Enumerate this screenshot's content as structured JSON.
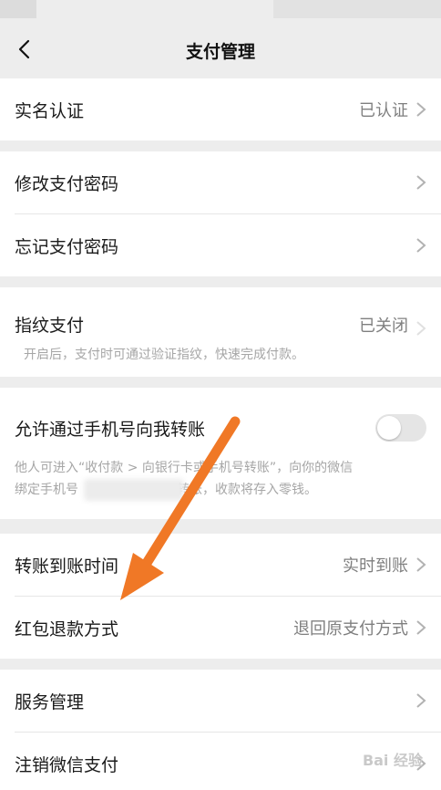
{
  "header": {
    "title": "支付管理"
  },
  "sections": {
    "identity": {
      "label": "实名认证",
      "value": "已认证"
    },
    "change_password": {
      "label": "修改支付密码"
    },
    "forgot_password": {
      "label": "忘记支付密码"
    },
    "fingerprint": {
      "label": "指纹支付",
      "value": "已关闭",
      "desc": "开启后，支付时可通过验证指纹，快速完成付款。"
    },
    "phone_transfer": {
      "label": "允许通过手机号向我转账",
      "desc_line1": "他人可进入“收付款 > 向银行卡或手机号转账”，向你的微信",
      "desc_line2_a": "绑定手机号",
      "desc_line2_b": "转账，收款将存入零钱。",
      "enabled": false
    },
    "transfer_time": {
      "label": "转账到账时间",
      "value": "实时到账"
    },
    "red_packet_refund": {
      "label": "红包退款方式",
      "value": "退回原支付方式"
    },
    "service_mgmt": {
      "label": "服务管理"
    },
    "cancel_pay": {
      "label": "注销微信支付"
    }
  },
  "colors": {
    "annotation_arrow": "#f07826",
    "toggle_off": "#e5e5e5",
    "secondary_text": "#7f7f7f"
  },
  "watermark": "Bai 经验"
}
